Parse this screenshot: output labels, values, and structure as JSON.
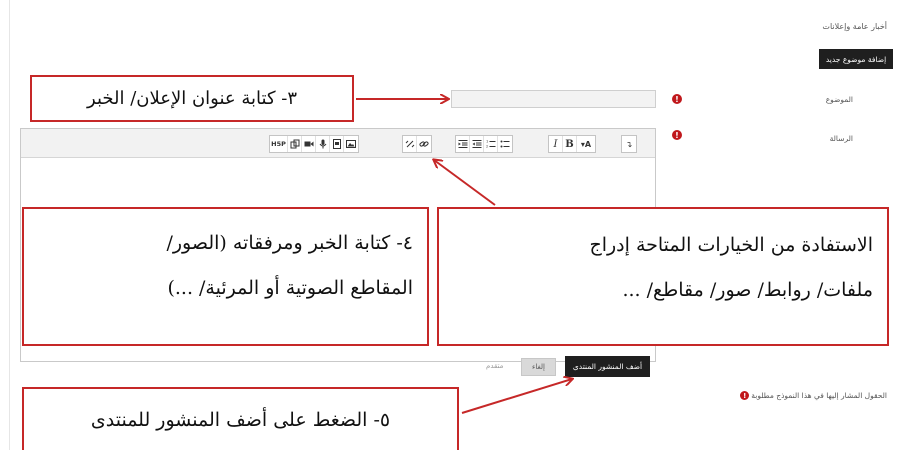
{
  "breadcrumb": "أخبار عامة وإعلانات",
  "add_topic_label": "إضافة موضوع جديد",
  "form": {
    "subject_label": "الموضوع",
    "subject_value": "",
    "message_label": "الرسالة",
    "required_mark": "!"
  },
  "toolbar": {
    "buttons": [
      {
        "icon": "h5p-icon",
        "text": "H5P"
      },
      {
        "icon": "copy-icon"
      },
      {
        "icon": "video-icon"
      },
      {
        "icon": "microphone-icon"
      },
      {
        "icon": "media-file-icon"
      },
      {
        "icon": "image-icon"
      },
      {
        "icon": "unlink-icon"
      },
      {
        "icon": "link-icon"
      },
      {
        "icon": "indent-icon"
      },
      {
        "icon": "outdent-icon"
      },
      {
        "icon": "numbered-list-icon"
      },
      {
        "icon": "bullet-list-icon"
      },
      {
        "icon": "italic-icon",
        "text": "I"
      },
      {
        "icon": "bold-icon",
        "text": "B"
      },
      {
        "icon": "font-style-icon",
        "text": "▾A"
      },
      {
        "icon": "toggle-toolbar-icon",
        "text": "↴"
      }
    ]
  },
  "actions": {
    "post_label": "أضف المنشور المنتدى",
    "cancel_label": "إلغاء",
    "advanced_label": "متقدم"
  },
  "required_note": "الحقول المشار إليها في هذا النموذج مطلوبة",
  "callouts": {
    "step3": "٣- كتابة عنوان الإعلان/ الخبر",
    "step4_line1": "٤- كتابة الخبر ومرفقاته (الصور/",
    "step4_line2": "المقاطع الصوتية أو المرئية/ ...)",
    "options_line1": "الاستفادة من الخيارات المتاحة إدراج",
    "options_line2": "ملفات/ روابط/ صور/ مقاطع/ ...",
    "step5": "٥- الضغط على أضف المنشور للمنتدى"
  },
  "colors": {
    "callout_border": "#c62828",
    "required_icon": "#c0181c",
    "primary_button": "#1f1f1f"
  }
}
